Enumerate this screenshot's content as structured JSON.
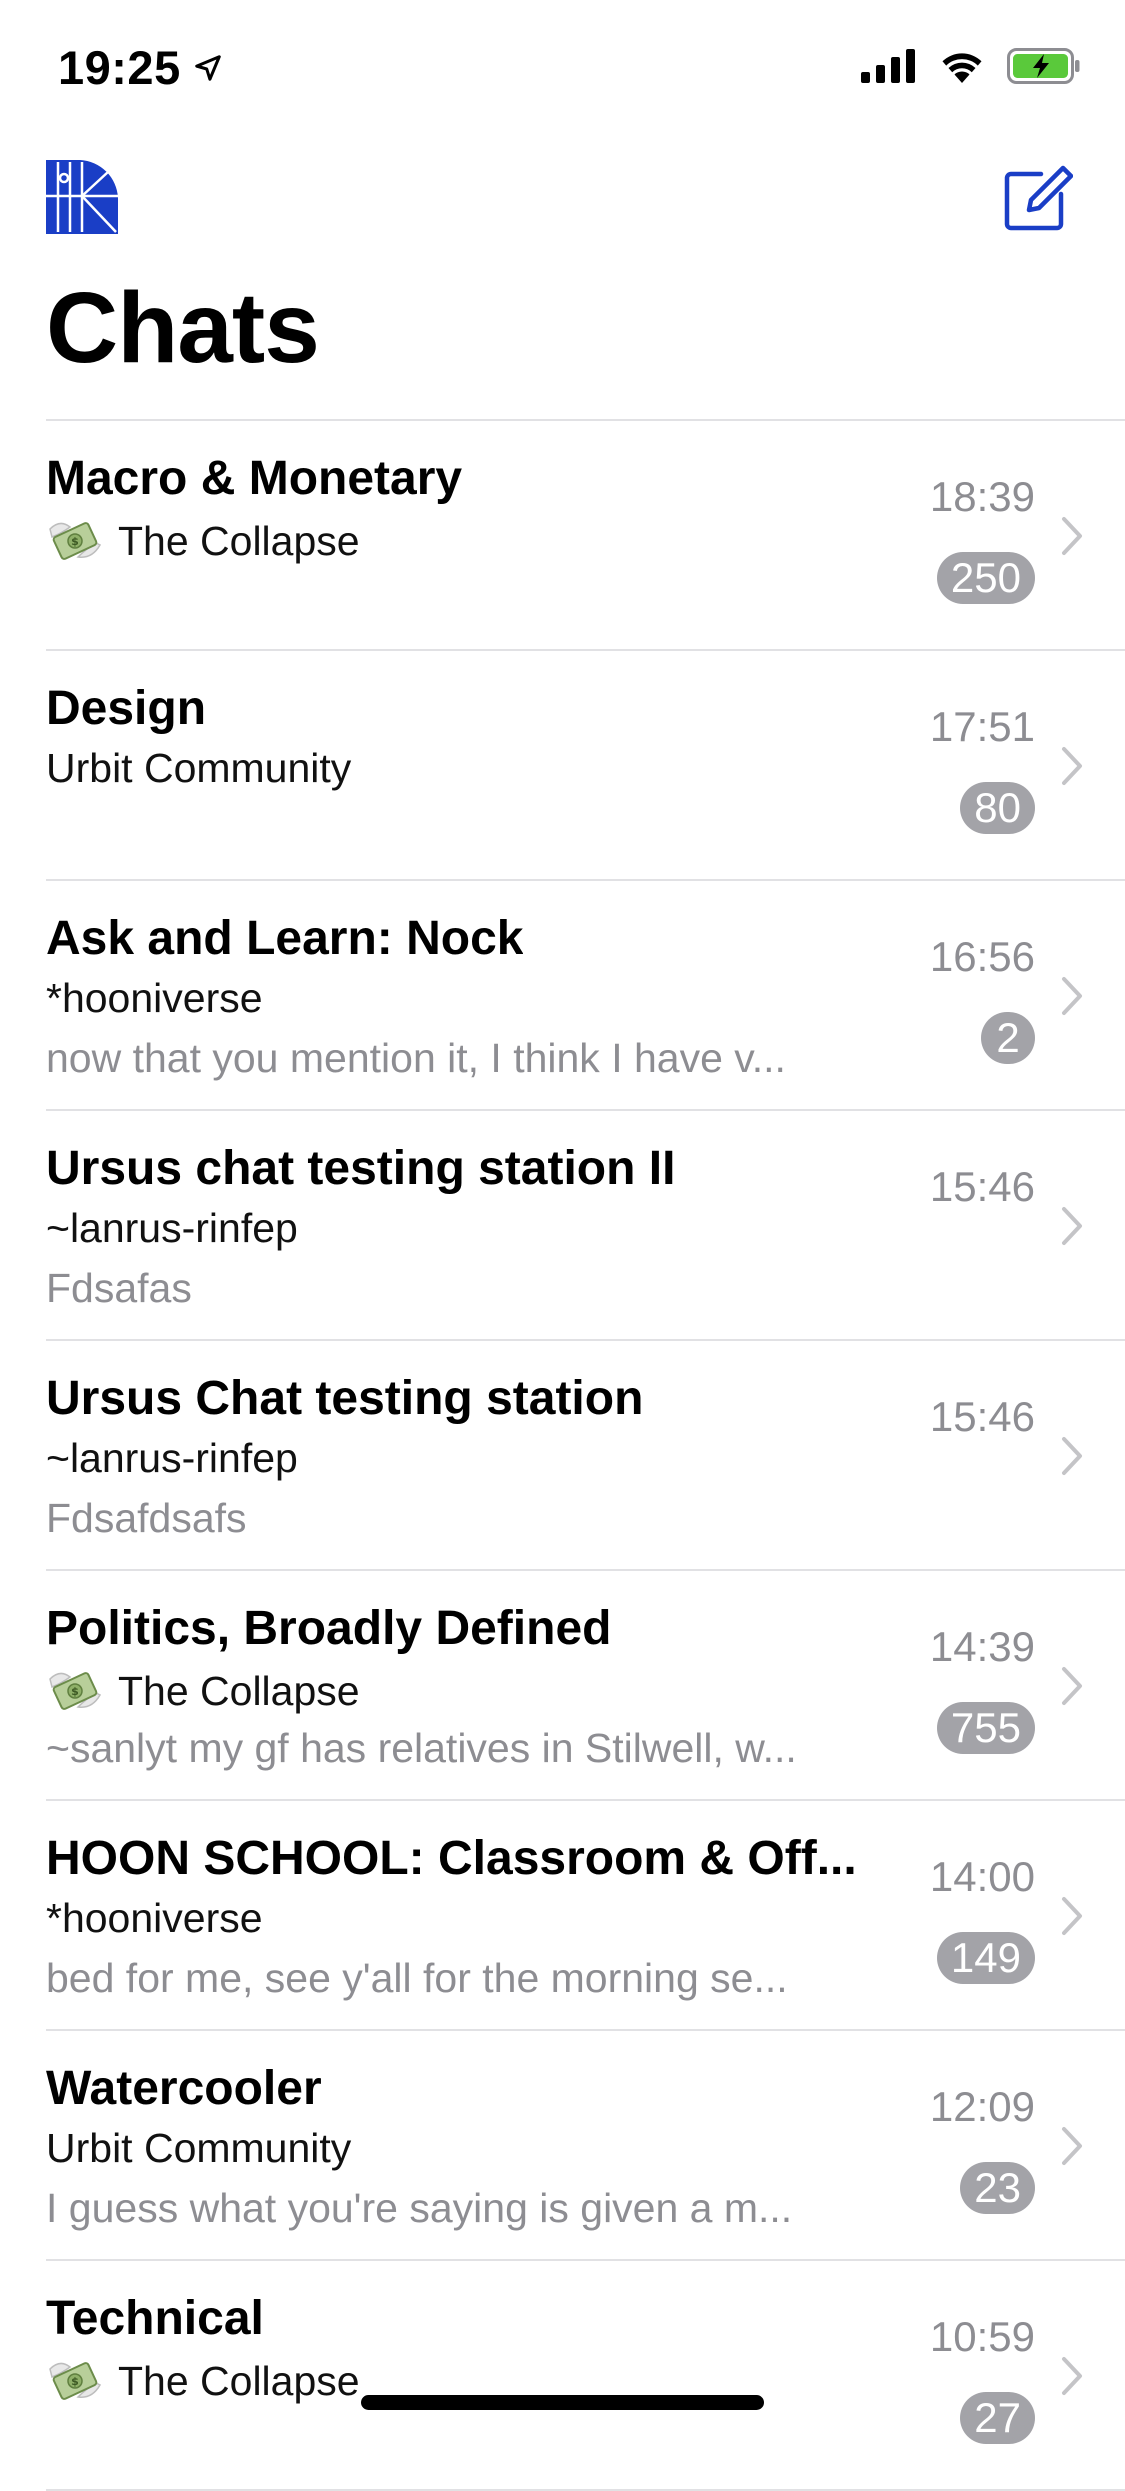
{
  "status_bar": {
    "time": "19:25",
    "location_icon": "location-arrow-icon",
    "signal_icon": "cellular-signal-icon",
    "wifi_icon": "wifi-icon",
    "battery_icon": "battery-charging-icon",
    "battery_color": "#5ac93b"
  },
  "nav": {
    "logo_icon": "urbit-logo-icon",
    "logo_color": "#1a3ec6",
    "compose_icon": "compose-icon",
    "accent_color": "#1a3ec6"
  },
  "page": {
    "title": "Chats"
  },
  "chats": [
    {
      "title": "Macro & Monetary",
      "group": "The Collapse",
      "group_icon": "money-with-wings-icon",
      "preview": "",
      "time": "18:39",
      "unread": "250"
    },
    {
      "title": "Design",
      "group": "Urbit Community",
      "group_icon": "",
      "preview": "",
      "time": "17:51",
      "unread": "80"
    },
    {
      "title": "Ask and Learn: Nock",
      "group": "*hooniverse",
      "group_icon": "",
      "preview": "now that you mention it, I think I have v...",
      "time": "16:56",
      "unread": "2"
    },
    {
      "title": "Ursus chat testing station II",
      "group": "~lanrus-rinfep",
      "group_icon": "",
      "preview": "Fdsafas",
      "time": "15:46",
      "unread": ""
    },
    {
      "title": "Ursus Chat testing station",
      "group": "~lanrus-rinfep",
      "group_icon": "",
      "preview": "Fdsafdsafs",
      "time": "15:46",
      "unread": ""
    },
    {
      "title": "Politics, Broadly Defined",
      "group": "The Collapse",
      "group_icon": "money-with-wings-icon",
      "preview": "~sanlyt my gf has relatives in Stilwell, w...",
      "time": "14:39",
      "unread": "755"
    },
    {
      "title": "HOON SCHOOL: Classroom & Off...",
      "group": "*hooniverse",
      "group_icon": "",
      "preview": "bed for me, see y'all for the morning se...",
      "time": "14:00",
      "unread": "149"
    },
    {
      "title": "Watercooler",
      "group": "Urbit Community",
      "group_icon": "",
      "preview": "I guess what you're saying is given a m...",
      "time": "12:09",
      "unread": "23"
    },
    {
      "title": "Technical",
      "group": "The Collapse",
      "group_icon": "money-with-wings-icon",
      "preview": "",
      "time": "10:59",
      "unread": "27"
    }
  ]
}
